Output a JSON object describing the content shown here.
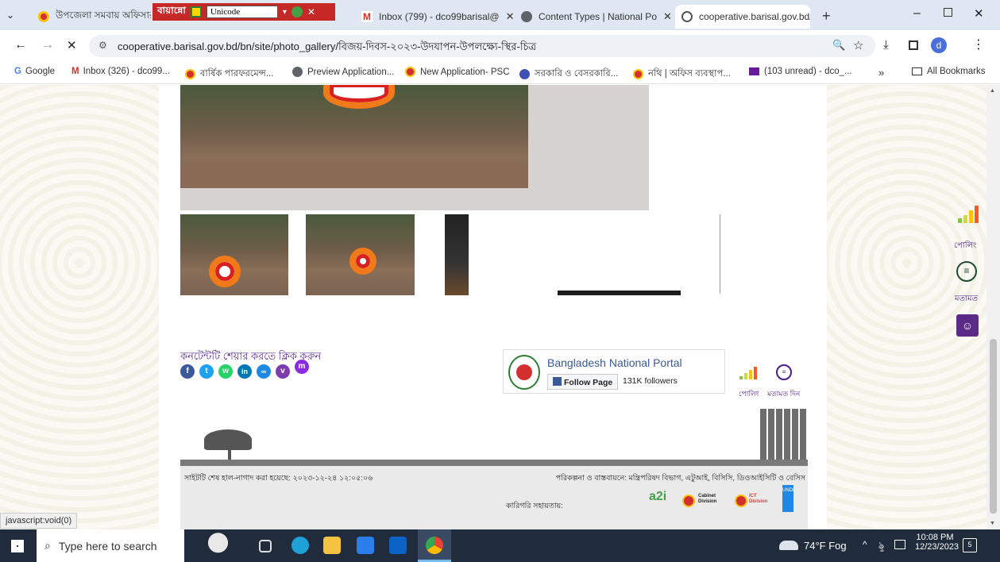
{
  "browser": {
    "tabs": [
      {
        "label": "উপজেলা সমবায় অফিসার"
      },
      {
        "label": "Inbox (799) - dco99barisal@"
      },
      {
        "label": "Content Types | National Po"
      },
      {
        "label": "cooperative.barisal.gov.bd/b"
      }
    ],
    "url": "cooperative.barisal.gov.bd/bn/site/photo_gallery/বিজয়-দিবস-২০২৩-উদযাপন-উপলক্ষ্যে-স্থির-চিত্র",
    "toolbar_overlay": {
      "keyboard_label": "বায়ান্নো",
      "font_select": "Unicode"
    },
    "profile_initial": "d",
    "bookmarks": [
      {
        "label": "Google",
        "icon": "google-icon"
      },
      {
        "label": "Inbox (326) - dco99...",
        "icon": "gmail-icon"
      },
      {
        "label": "বার্ষিক পারফরমেন্স...",
        "icon": "bd-govt-icon"
      },
      {
        "label": "Preview Application...",
        "icon": "globe-icon"
      },
      {
        "label": "New Application- PSC",
        "icon": "bd-govt-icon"
      },
      {
        "label": "সরকারি ও বেসরকারি...",
        "icon": "seal-icon"
      },
      {
        "label": "নথি | অফিস ব্যবস্থাপ...",
        "icon": "bd-govt-icon"
      },
      {
        "label": "(103 unread) - dco_...",
        "icon": "mail-icon"
      }
    ],
    "bookmarks_more": "»",
    "all_bookmarks": "All Bookmarks",
    "status_url": "javascript:void(0)"
  },
  "page": {
    "share_text": "কনটেন্টটি শেয়ার করতে ক্লিক করুন",
    "share_icons": [
      {
        "name": "facebook",
        "color": "#3b5998",
        "glyph": "f"
      },
      {
        "name": "twitter",
        "color": "#1da1f2",
        "glyph": "t"
      },
      {
        "name": "whatsapp",
        "color": "#25d366",
        "glyph": "w"
      },
      {
        "name": "linkedin",
        "color": "#0077b5",
        "glyph": "in"
      },
      {
        "name": "copy-link",
        "color": "#1e88e5",
        "glyph": "🔗"
      },
      {
        "name": "viber",
        "color": "#7d3daf",
        "glyph": "v"
      },
      {
        "name": "messenger",
        "color": "#8a2be2",
        "glyph": "m"
      }
    ],
    "portal_card": {
      "title": "Bangladesh National Portal",
      "follow_label": "Follow Page",
      "followers": "131K followers"
    },
    "poll_label": "পোলিং",
    "opinion_label": "মতামত দিন",
    "side_poll_label": "পোলিং",
    "side_opinion_label": "মতামত",
    "footer": {
      "updated": "সাইটটি শেষ হাল-নাগাদ করা হয়েছে: ২০২৩-১২-২৪ ১২:০৫:০৬",
      "planning": "পরিকল্পনা ও বাস্তবায়নে: মন্ত্রিপরিষদ বিভাগ, এটুআই, বিসিসি, ডিওআইসিটি ও বেসিস",
      "tech_support": "কারিগরি সহায়তায়:",
      "partners": [
        "a2i",
        "Cabinet Division",
        "ICT Division",
        "UNDP"
      ]
    }
  },
  "taskbar": {
    "search_placeholder": "Type here to search",
    "weather": "74°F Fog",
    "time": "10:08 PM",
    "date": "12/23/2023",
    "notifications": "5"
  }
}
